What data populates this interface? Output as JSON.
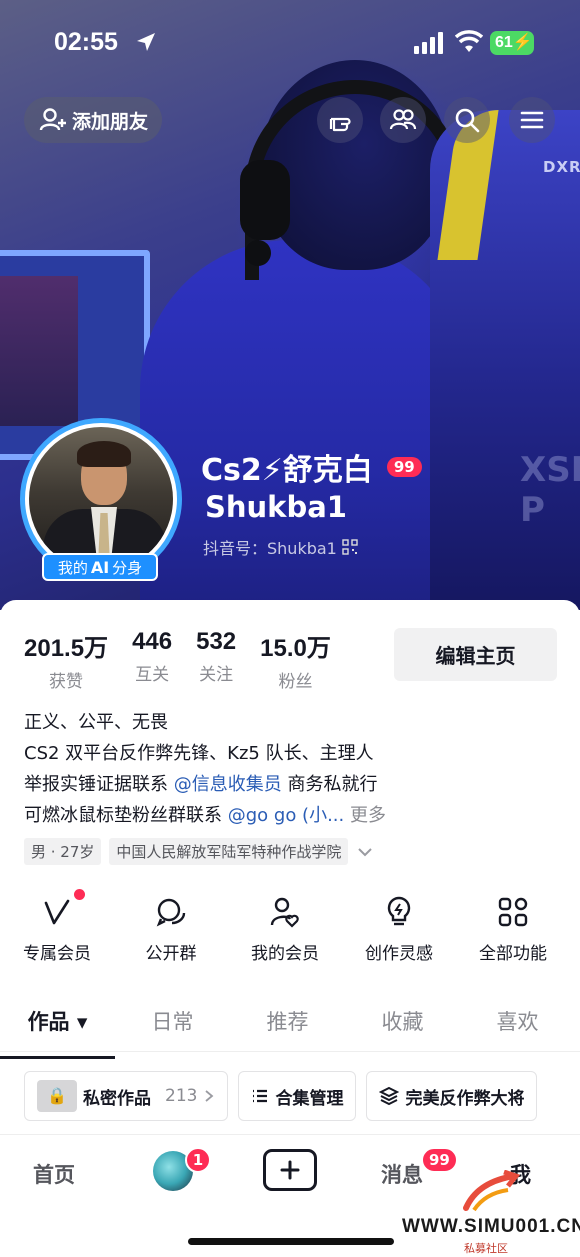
{
  "status_bar": {
    "time": "02:55",
    "battery": "61"
  },
  "top_bar": {
    "add_friend_label": "添加朋友"
  },
  "hero": {
    "chair_logo": "DXR",
    "chair_text": "XSE P"
  },
  "profile": {
    "name": "Cs2⚡舒克白",
    "name_badge": "99",
    "subname": "Shukba1",
    "douyin_id": "抖音号：Shukba1",
    "ai_badge_prefix": "我的",
    "ai_badge_ai": "AI",
    "ai_badge_suffix": "分身"
  },
  "stats": [
    {
      "value": "201.5万",
      "label": "获赞"
    },
    {
      "value": "446",
      "label": "互关"
    },
    {
      "value": "532",
      "label": "关注"
    },
    {
      "value": "15.0万",
      "label": "粉丝"
    }
  ],
  "edit_button": "编辑主页",
  "bio": {
    "line1": "正义、公平、无畏",
    "line2": "CS2 双平台反作弊先锋、Kz5 队长、主理人",
    "line3_a": "举报实锤证据联系 ",
    "line3_link": "@信息收集员",
    "line3_b": " 商务私就行",
    "line4_a": "可燃冰鼠标垫粉丝群联系 ",
    "line4_link": "@go go (小...",
    "line4_more": " 更多"
  },
  "tags": [
    "男 · 27岁",
    "中国人民解放军陆军特种作战学院"
  ],
  "features": [
    {
      "icon": "v-member-icon",
      "label": "专属会员",
      "dot": true
    },
    {
      "icon": "chat-group-icon",
      "label": "公开群",
      "dot": false
    },
    {
      "icon": "user-heart-icon",
      "label": "我的会员",
      "dot": false
    },
    {
      "icon": "lightbulb-icon",
      "label": "创作灵感",
      "dot": false
    },
    {
      "icon": "grid-icon",
      "label": "全部功能",
      "dot": false
    }
  ],
  "tabs": [
    {
      "label": "作品 ▾",
      "active": true
    },
    {
      "label": "日常",
      "active": false
    },
    {
      "label": "推荐",
      "active": false
    },
    {
      "label": "收藏",
      "active": false
    },
    {
      "label": "喜欢",
      "active": false
    }
  ],
  "chips": {
    "private_label": "私密作品",
    "private_count": "213",
    "collection_label": "合集管理",
    "anticheat_label": "完美反作弊大将"
  },
  "bottom_nav": {
    "home": "首页",
    "avatar_badge": "1",
    "messages": "消息",
    "messages_badge": "99",
    "me": "我"
  },
  "watermark": {
    "site": "WWW.SIMU001.CN",
    "sub": "私募社区"
  },
  "colors": {
    "accent_red": "#fe2c55",
    "ai_blue": "#1e90ff",
    "link_blue": "#2b5db5"
  }
}
